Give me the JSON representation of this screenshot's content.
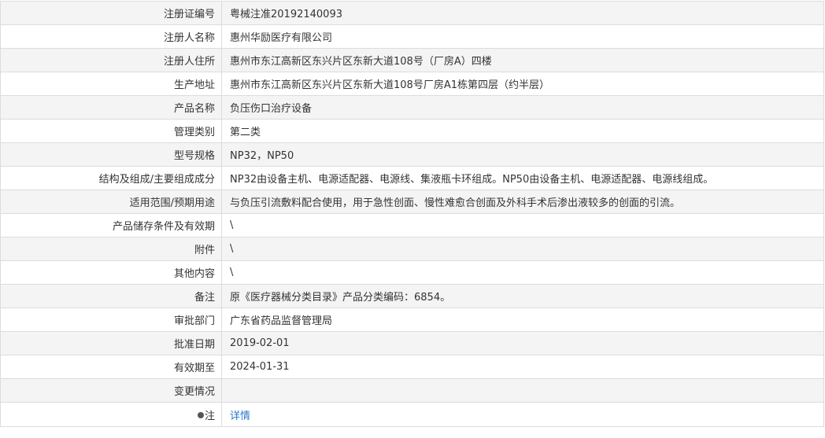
{
  "fields": [
    {
      "label": "注册证编号",
      "value": "粤械注准20192140093"
    },
    {
      "label": "注册人名称",
      "value": "惠州华励医疗有限公司"
    },
    {
      "label": "注册人住所",
      "value": "惠州市东江高新区东兴片区东新大道108号（厂房A）四楼"
    },
    {
      "label": "生产地址",
      "value": "惠州市东江高新区东兴片区东新大道108号厂房A1栋第四层（约半层）"
    },
    {
      "label": "产品名称",
      "value": "负压伤口治疗设备"
    },
    {
      "label": "管理类别",
      "value": "第二类"
    },
    {
      "label": "型号规格",
      "value": "NP32，NP50"
    },
    {
      "label": "结构及组成/主要组成成分",
      "value": "NP32由设备主机、电源适配器、电源线、集液瓶卡环组成。NP50由设备主机、电源适配器、电源线组成。"
    },
    {
      "label": "适用范围/预期用途",
      "value": "与负压引流敷料配合使用，用于急性创面、慢性难愈合创面及外科手术后渗出液较多的创面的引流。"
    },
    {
      "label": "产品储存条件及有效期",
      "value": "\\"
    },
    {
      "label": "附件",
      "value": "\\"
    },
    {
      "label": "其他内容",
      "value": "\\"
    },
    {
      "label": "备注",
      "value": "原《医疗器械分类目录》产品分类编码：6854。"
    },
    {
      "label": "审批部门",
      "value": "广东省药品监督管理局"
    },
    {
      "label": "批准日期",
      "value": "2019-02-01"
    },
    {
      "label": "有效期至",
      "value": "2024-01-31"
    },
    {
      "label": "变更情况",
      "value": ""
    }
  ],
  "note": {
    "label": "注",
    "icon": "bullet-icon",
    "link_text": "详情"
  },
  "colors": {
    "row_alt": "#f4f4f4",
    "row_plain": "#ffffff",
    "border": "#dcdcdc",
    "text": "#333333",
    "link": "#2a78c8"
  }
}
